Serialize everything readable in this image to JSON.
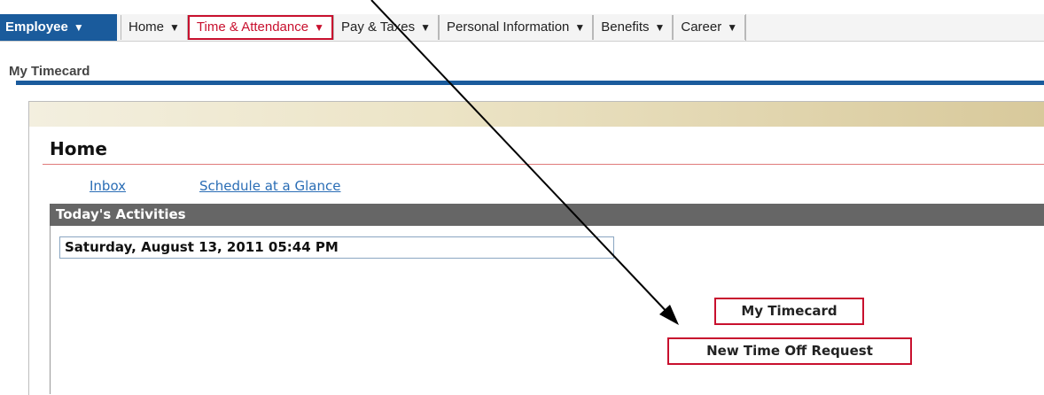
{
  "nav": {
    "employee_label": "Employee",
    "tabs": [
      {
        "label": "Home"
      },
      {
        "label": "Time & Attendance"
      },
      {
        "label": "Pay & Taxes"
      },
      {
        "label": "Personal Information"
      },
      {
        "label": "Benefits"
      },
      {
        "label": "Career"
      }
    ],
    "active_tab": "Time & Attendance"
  },
  "page": {
    "title": "My Timecard"
  },
  "main": {
    "heading": "Home",
    "links": [
      {
        "label": "Inbox"
      },
      {
        "label": "Schedule at a Glance"
      }
    ],
    "activities_title": "Today's Activities",
    "datetime": "Saturday, August 13, 2011 05:44 PM",
    "buttons": {
      "my_timecard": "My Timecard",
      "new_time_off_request": "New Time Off Request"
    }
  },
  "colors": {
    "brand_blue": "#1a5b9c",
    "accent_red": "#c8102e",
    "link_blue": "#2a6db5",
    "header_gray": "#666666"
  },
  "icons": {
    "dropdown": "caret-down-icon",
    "annotation": "pointer-arrow-icon"
  }
}
